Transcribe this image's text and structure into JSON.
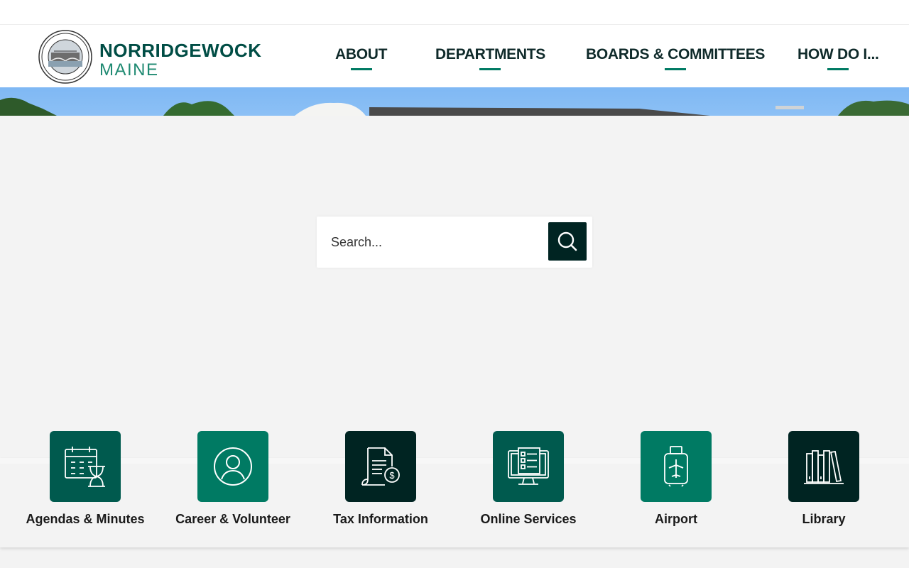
{
  "header": {
    "logo_name": "NORRIDGEWOCK",
    "logo_state": "MAINE"
  },
  "nav": {
    "items": [
      {
        "label": "ABOUT"
      },
      {
        "label": "DEPARTMENTS"
      },
      {
        "label": "BOARDS & COMMITTEES"
      },
      {
        "label": "HOW DO I..."
      }
    ]
  },
  "search": {
    "placeholder": "Search..."
  },
  "quicklinks": [
    {
      "label": "Agendas & Minutes",
      "icon": "calendar-hourglass-icon",
      "color": "#005a4e"
    },
    {
      "label": "Career & Volunteer",
      "icon": "person-icon",
      "color": "#007a63"
    },
    {
      "label": "Tax Information",
      "icon": "tax-document-icon",
      "color": "#002422"
    },
    {
      "label": "Online Services",
      "icon": "computer-checklist-icon",
      "color": "#005a4e"
    },
    {
      "label": "Airport",
      "icon": "airport-luggage-icon",
      "color": "#007a63"
    },
    {
      "label": "Library",
      "icon": "books-icon",
      "color": "#002422"
    }
  ],
  "colors": {
    "dark": "#002422",
    "brand": "#005a4e",
    "accent": "#007a63"
  }
}
